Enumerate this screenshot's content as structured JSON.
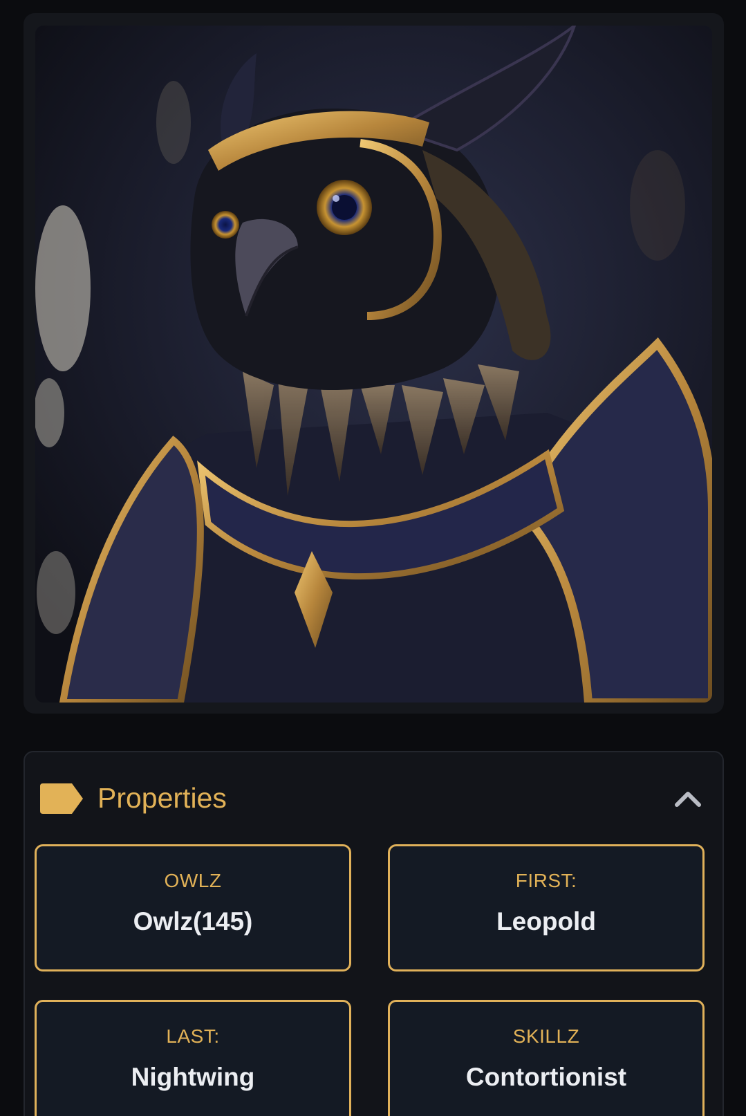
{
  "nft": {
    "image_subject": "armored owl portrait"
  },
  "properties": {
    "title": "Properties",
    "items": [
      {
        "type": "OWLZ",
        "value": "Owlz(145)"
      },
      {
        "type": "FIRST:",
        "value": "Leopold"
      },
      {
        "type": "LAST:",
        "value": "Nightwing"
      },
      {
        "type": "SKILLZ",
        "value": "Contortionist"
      }
    ]
  },
  "colors": {
    "accent": "#e2b257",
    "background": "#0b0c0f",
    "card": "#141a24"
  },
  "icons": {
    "tag": "tag-icon",
    "collapse": "chevron-up-icon"
  }
}
